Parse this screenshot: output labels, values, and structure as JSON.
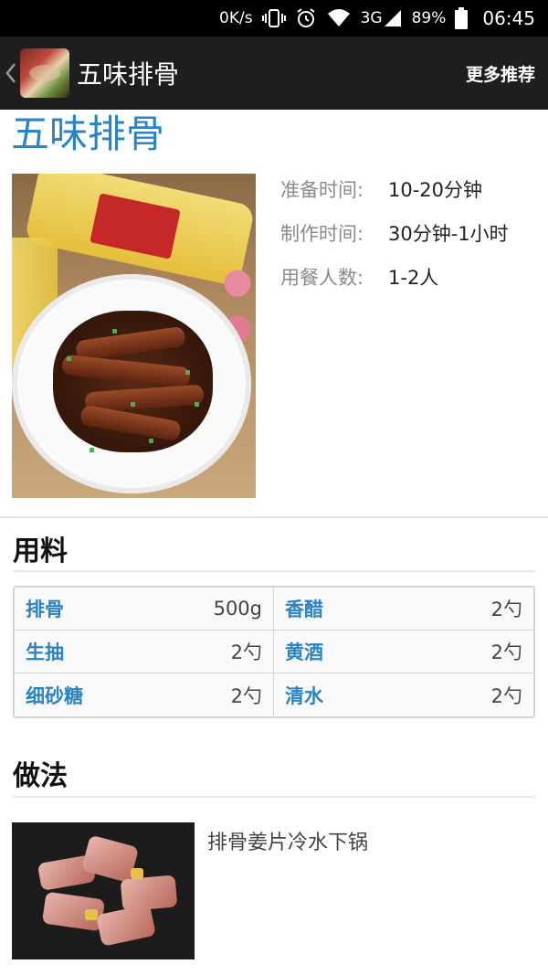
{
  "status_bar": {
    "speed": "0K/s",
    "network": "3G",
    "battery": "89%",
    "time": "06:45"
  },
  "app_bar": {
    "title": "五味排骨",
    "more_label": "更多推荐"
  },
  "recipe": {
    "title": "五味排骨",
    "info": [
      {
        "label": "准备时间:",
        "value": "10-20分钟"
      },
      {
        "label": "制作时间:",
        "value": "30分钟-1小时"
      },
      {
        "label": "用餐人数:",
        "value": "1-2人"
      }
    ]
  },
  "ingredients": {
    "section_title": "用料",
    "items": [
      {
        "name": "排骨",
        "qty": "500g"
      },
      {
        "name": "香醋",
        "qty": "2勺"
      },
      {
        "name": "生抽",
        "qty": "2勺"
      },
      {
        "name": "黄酒",
        "qty": "2勺"
      },
      {
        "name": "细砂糖",
        "qty": "2勺"
      },
      {
        "name": "清水",
        "qty": "2勺"
      }
    ]
  },
  "method": {
    "section_title": "做法",
    "steps": [
      {
        "text": "排骨姜片冷水下锅"
      }
    ]
  },
  "colors": {
    "accent_blue": "#2a83c4",
    "app_bar": "#1e1e1e",
    "status_bar": "#000000"
  },
  "icons": [
    "vibrate-icon",
    "alarm-icon",
    "wifi-icon",
    "signal-icon",
    "battery-icon",
    "back-chevron-icon"
  ]
}
